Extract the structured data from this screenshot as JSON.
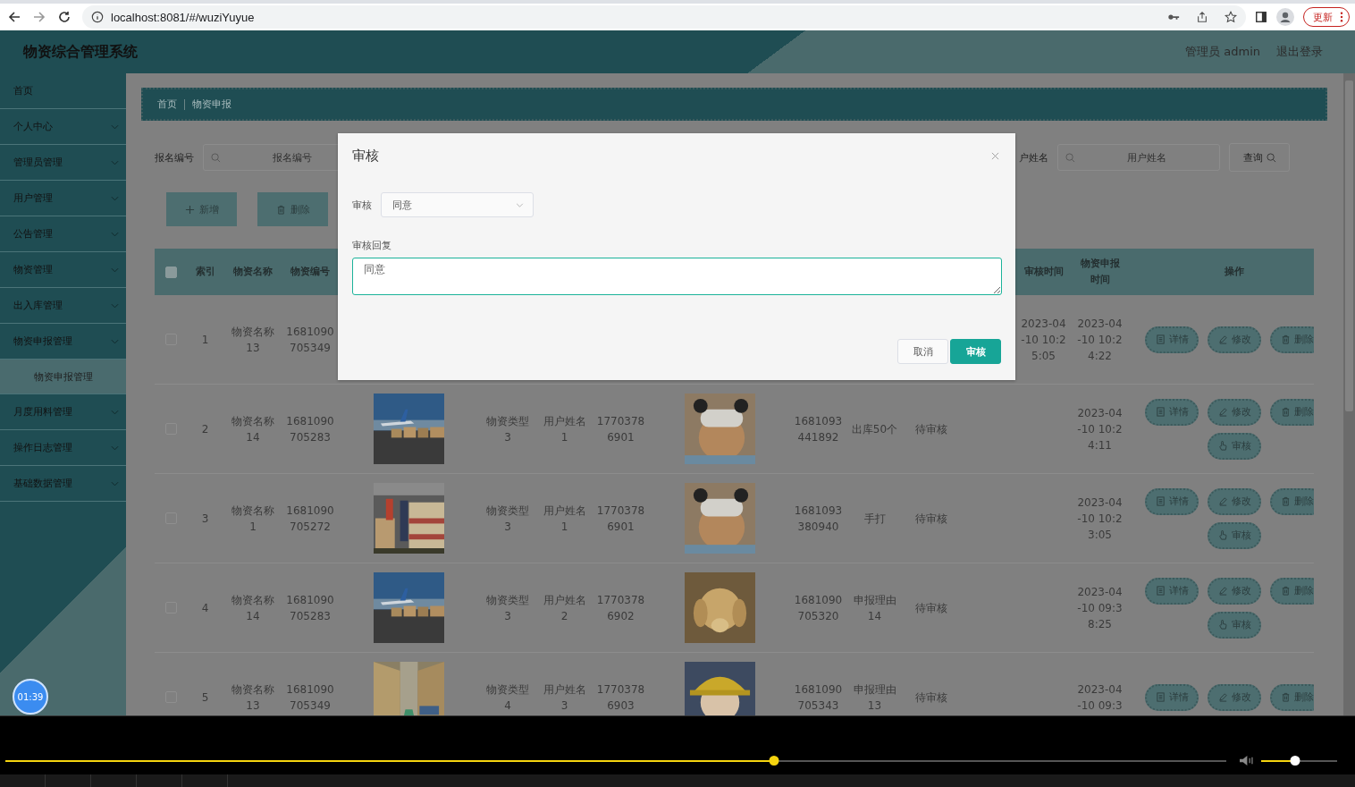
{
  "browser": {
    "url": "localhost:8081/#/wuziYuyue",
    "update_button": "更新"
  },
  "header": {
    "title": "物资综合管理系统",
    "user": "管理员 admin",
    "logout": "退出登录"
  },
  "sidebar": {
    "items": [
      {
        "kind": "link",
        "label": "首页"
      },
      {
        "kind": "menu",
        "label": "个人中心"
      },
      {
        "kind": "menu",
        "label": "管理员管理"
      },
      {
        "kind": "menu",
        "label": "用户管理"
      },
      {
        "kind": "menu",
        "label": "公告管理"
      },
      {
        "kind": "menu",
        "label": "物资管理"
      },
      {
        "kind": "menu",
        "label": "出入库管理"
      },
      {
        "kind": "menu",
        "label": "物资申报管理",
        "children": [
          {
            "label": "物资申报管理",
            "selected": true
          }
        ]
      },
      {
        "kind": "menu",
        "label": "月度用料管理"
      },
      {
        "kind": "menu",
        "label": "操作日志管理"
      },
      {
        "kind": "menu",
        "label": "基础数据管理"
      }
    ]
  },
  "breadcrumb": [
    "首页",
    "物资申报"
  ],
  "search": {
    "fields": [
      {
        "label": "报名编号",
        "placeholder": "报名编号"
      },
      {
        "label": "户姓名",
        "placeholder": "用户姓名"
      }
    ],
    "button": "查询"
  },
  "toolbar": [
    {
      "kind": "add",
      "label": "新增"
    },
    {
      "kind": "delete",
      "label": "删除"
    }
  ],
  "table": {
    "header_checked": false,
    "left_columns": [
      "索引",
      "物资名称",
      "物资编号"
    ],
    "right_columns": [
      "审核时间",
      "物资申报时间",
      "操作"
    ],
    "rows": [
      {
        "checked": false,
        "index": "1",
        "name": "物资名称 13",
        "code": "1681090705349",
        "audit_time": "2023-04-10 10:25:05",
        "declared_time": "2023-04-10 10:24:22",
        "actions": [
          {
            "kind": "detail",
            "label": "详情"
          },
          {
            "kind": "edit",
            "label": "修改"
          },
          {
            "kind": "delete",
            "label": "删除"
          }
        ]
      },
      {
        "checked": false,
        "index": "2",
        "name": "物资名称 14",
        "code": "1681090705283",
        "image": {
          "kind": "picture"
        },
        "type": "物资类型 3",
        "user": "用户姓名 1",
        "phone": "17703786901",
        "avatar": {
          "kind": "picture"
        },
        "number": "1681093441892",
        "reason": "出库50个",
        "status": "待审核",
        "declared_time": "2023-04-10 10:24:11",
        "actions": [
          {
            "kind": "detail",
            "label": "详情"
          },
          {
            "kind": "edit",
            "label": "修改"
          },
          {
            "kind": "delete",
            "label": "删除"
          },
          {
            "kind": "audit",
            "label": "审核"
          }
        ]
      },
      {
        "checked": false,
        "index": "3",
        "name": "物资名称 1",
        "code": "1681090705272",
        "image": {
          "kind": "picture"
        },
        "type": "物资类型 3",
        "user": "用户姓名 1",
        "phone": "17703786901",
        "avatar": {
          "kind": "picture"
        },
        "number": "1681093380940",
        "reason": "手打",
        "status": "待审核",
        "declared_time": "2023-04-10 10:23:05",
        "actions": [
          {
            "kind": "detail",
            "label": "详情"
          },
          {
            "kind": "edit",
            "label": "修改"
          },
          {
            "kind": "delete",
            "label": "删除"
          },
          {
            "kind": "audit",
            "label": "审核"
          }
        ]
      },
      {
        "checked": false,
        "index": "4",
        "name": "物资名称 14",
        "code": "1681090705283",
        "image": {
          "kind": "picture"
        },
        "type": "物资类型 3",
        "user": "用户姓名 2",
        "phone": "17703786902",
        "avatar": {
          "kind": "picture"
        },
        "number": "1681090705320",
        "reason": "申报理由 14",
        "status": "待审核",
        "declared_time": "2023-04-10 09:38:25",
        "actions": [
          {
            "kind": "detail",
            "label": "详情"
          },
          {
            "kind": "edit",
            "label": "修改"
          },
          {
            "kind": "delete",
            "label": "删除"
          },
          {
            "kind": "audit",
            "label": "审核"
          }
        ]
      },
      {
        "checked": false,
        "index": "5",
        "name": "物资名称 13",
        "code": "1681090705349",
        "image": {
          "kind": "picture"
        },
        "type": "物资类型 4",
        "user": "用户姓名 3",
        "phone": "17703786903",
        "avatar": {
          "kind": "picture"
        },
        "number": "1681090705343",
        "reason": "申报理由 13",
        "status": "待审核",
        "declared_time": "2023-04-10 09:3",
        "actions": [
          {
            "kind": "detail",
            "label": "详情"
          },
          {
            "kind": "edit",
            "label": "修改"
          },
          {
            "kind": "delete",
            "label": "删除"
          }
        ]
      }
    ]
  },
  "modal": {
    "title": "审核",
    "select_label": "审核",
    "select_value": "同意",
    "reply_label": "审核回复",
    "reply": {
      "value": "同意",
      "focused": true
    },
    "buttons": [
      {
        "kind": "cancel",
        "label": "取消"
      },
      {
        "kind": "primary",
        "label": "审核"
      }
    ]
  },
  "timer": "01:39",
  "player": {
    "progress": {
      "level": 0.63
    },
    "volume": {
      "level": 0.45
    }
  }
}
